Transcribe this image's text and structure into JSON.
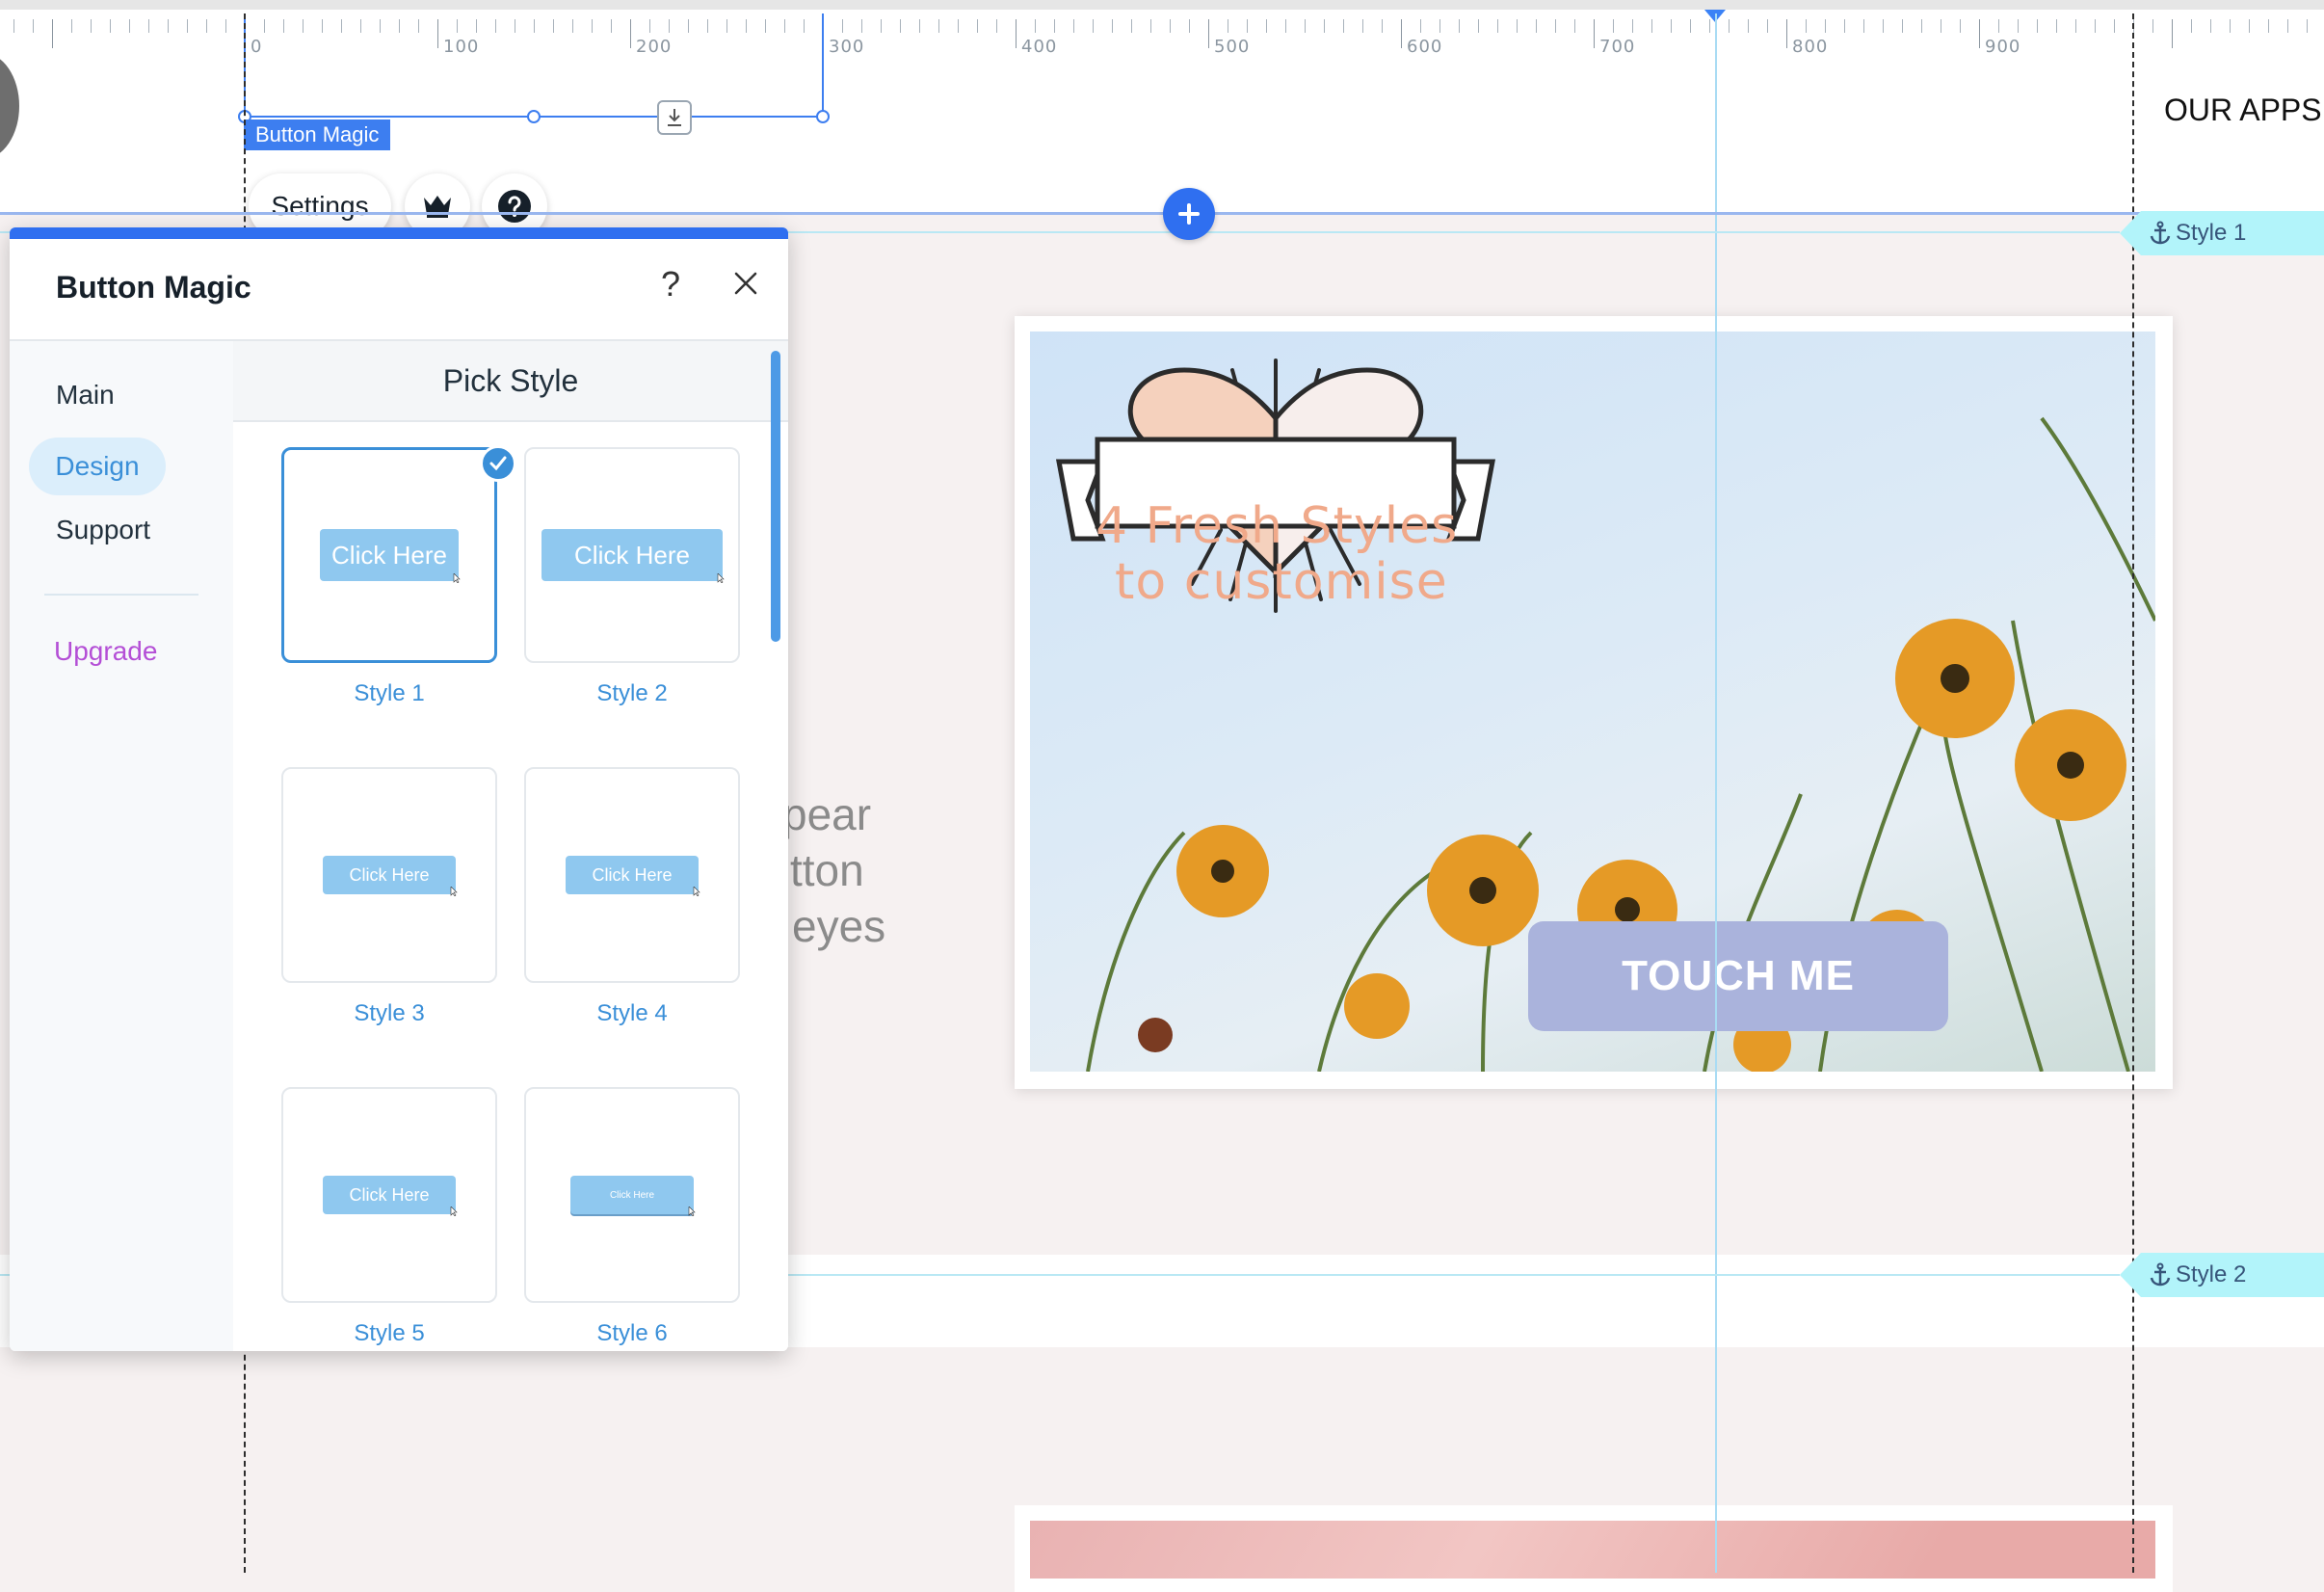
{
  "ruler": {
    "labels": [
      "0",
      "100",
      "200",
      "300",
      "400",
      "500",
      "600",
      "700",
      "800",
      "900"
    ]
  },
  "selection": {
    "tag": "Button Magic"
  },
  "toolbar": {
    "settings_label": "Settings",
    "crown_icon": "crown-icon",
    "help_icon": "help-icon"
  },
  "header": {
    "nav_link": "OUR APPS"
  },
  "anchors": {
    "style1": "Style 1",
    "style2": "Style 2"
  },
  "background_text": {
    "line1": "pear",
    "line2": "tton",
    "line3": "eyes"
  },
  "hero": {
    "headline_line1": "4 Fresh Styles",
    "headline_line2": "to customise",
    "button_label": "TOUCH ME"
  },
  "panel": {
    "title": "Button Magic",
    "help": "?",
    "nav": {
      "main": "Main",
      "design": "Design",
      "support": "Support",
      "upgrade": "Upgrade"
    },
    "section_title": "Pick Style",
    "styles": [
      {
        "name": "Style 1",
        "button": "Click Here",
        "selected": true
      },
      {
        "name": "Style 2",
        "button": "Click Here",
        "selected": false
      },
      {
        "name": "Style 3",
        "button": "Click Here",
        "selected": false
      },
      {
        "name": "Style 4",
        "button": "Click Here",
        "selected": false
      },
      {
        "name": "Style 5",
        "button": "Click Here",
        "selected": false
      },
      {
        "name": "Style 6",
        "button": "Click Here",
        "selected": false
      }
    ]
  },
  "colors": {
    "accent_blue": "#2f6ff0",
    "link_blue": "#3a8fd8",
    "upgrade_purple": "#b44fd6",
    "sample_button": "#8fc8ef",
    "touch_button": "#aab3dc",
    "anchor_bg": "#b2f4fa"
  }
}
